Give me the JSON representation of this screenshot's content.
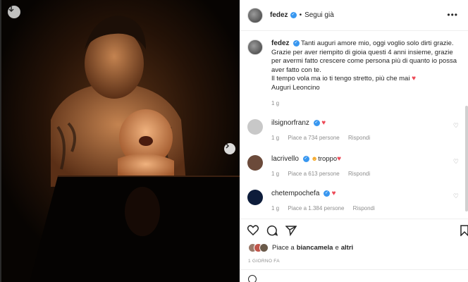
{
  "post": {
    "author": "fedez",
    "follow_label": "Segui già",
    "more_label": "•••",
    "caption_lines": [
      "Tanti auguri amore mio, oggi voglio solo dirti grazie.",
      "Grazie per aver riempito di gioia questi 4 anni insieme, grazie per avermi fatto crescere come persona più di quanto io possa aver fatto con te.",
      "Il tempo vola ma io ti tengo stretto, più che mai",
      "Auguri Leoncino"
    ],
    "caption_time": "1 g",
    "likes_prefix": "Piace a",
    "likes_user": "biancamela",
    "likes_and": "e",
    "likes_others": "altri",
    "date_label": "1 GIORNO FA"
  },
  "comments": [
    {
      "user": "ilsignorfranz",
      "text": "",
      "time": "1 g",
      "likes": "Piace a 734 persone",
      "reply": "Rispondi",
      "avatar_color": "#bdbdbd"
    },
    {
      "user": "lacrivello",
      "text": "troppo",
      "time": "1 g",
      "likes": "Piace a 613 persone",
      "reply": "Rispondi",
      "avatar_color": "#6b4a3a"
    },
    {
      "user": "chetempochefa",
      "text": "",
      "time": "1 g",
      "likes": "Piace a 1.384 persone",
      "reply": "Rispondi",
      "avatar_color": "#0d1c3a"
    }
  ],
  "icons": {
    "heart": "heart-icon",
    "comment": "comment-icon",
    "share": "share-icon",
    "bookmark": "bookmark-icon",
    "next": "chevron-right-icon",
    "download": "arrow-down-icon"
  },
  "colors": {
    "verified": "#3897f0",
    "heart": "#ed4956",
    "muted": "#8e8e8e"
  }
}
